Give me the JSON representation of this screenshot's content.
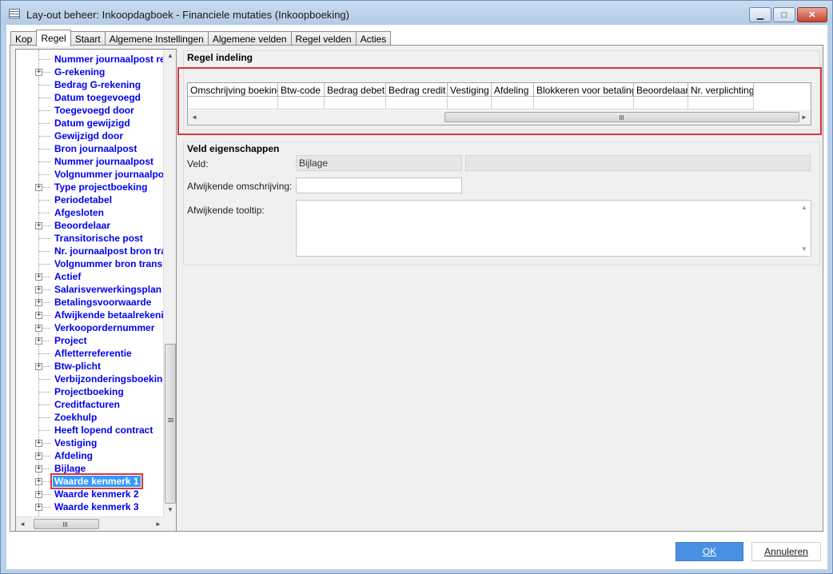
{
  "window": {
    "title": "Lay-out beheer: Inkoopdagboek - Financiele mutaties (Inkoopboeking)",
    "controls": {
      "minimize": "▁",
      "maximize": "□",
      "close": "✕"
    }
  },
  "tabs": [
    "Kop",
    "Regel",
    "Staart",
    "Algemene Instellingen",
    "Algemene velden",
    "Regel velden",
    "Acties"
  ],
  "active_tab": "Regel",
  "tree": {
    "items": [
      {
        "label": "Nummer journaalpost rek",
        "expandable": false
      },
      {
        "label": "G-rekening",
        "expandable": true
      },
      {
        "label": "Bedrag G-rekening",
        "expandable": false
      },
      {
        "label": "Datum toegevoegd",
        "expandable": false
      },
      {
        "label": "Toegevoegd door",
        "expandable": false
      },
      {
        "label": "Datum gewijzigd",
        "expandable": false
      },
      {
        "label": "Gewijzigd door",
        "expandable": false
      },
      {
        "label": "Bron journaalpost",
        "expandable": false
      },
      {
        "label": "Nummer journaalpost",
        "expandable": false
      },
      {
        "label": "Volgnummer journaalpos",
        "expandable": false
      },
      {
        "label": "Type projectboeking",
        "expandable": true
      },
      {
        "label": "Periodetabel",
        "expandable": false
      },
      {
        "label": "Afgesloten",
        "expandable": false
      },
      {
        "label": "Beoordelaar",
        "expandable": true
      },
      {
        "label": "Transitorische post",
        "expandable": false
      },
      {
        "label": "Nr. journaalpost bron tra",
        "expandable": false
      },
      {
        "label": "Volgnummer bron transit",
        "expandable": false
      },
      {
        "label": "Actief",
        "expandable": true
      },
      {
        "label": "Salarisverwerkingsplan",
        "expandable": true
      },
      {
        "label": "Betalingsvoorwaarde",
        "expandable": true
      },
      {
        "label": "Afwijkende betaalrekeni",
        "expandable": true
      },
      {
        "label": "Verkoopordernummer",
        "expandable": true
      },
      {
        "label": "Project",
        "expandable": true
      },
      {
        "label": "Afletterreferentie",
        "expandable": false
      },
      {
        "label": "Btw-plicht",
        "expandable": true
      },
      {
        "label": "Verbijzonderingsboeking",
        "expandable": false
      },
      {
        "label": "Projectboeking",
        "expandable": false
      },
      {
        "label": "Creditfacturen",
        "expandable": false
      },
      {
        "label": "Zoekhulp",
        "expandable": false
      },
      {
        "label": "Heeft lopend contract",
        "expandable": false
      },
      {
        "label": "Vestiging",
        "expandable": true
      },
      {
        "label": "Afdeling",
        "expandable": true
      },
      {
        "label": "Bijlage",
        "expandable": true
      },
      {
        "label": "Waarde kenmerk 1",
        "expandable": true,
        "selected": true
      },
      {
        "label": "Waarde kenmerk 2",
        "expandable": true
      },
      {
        "label": "Waarde kenmerk 3",
        "expandable": true
      }
    ],
    "scroll_icons": {
      "up": "▲",
      "down": "▼",
      "left": "◄",
      "right": "►",
      "grip": "≡",
      "hgrip": "III"
    }
  },
  "regel_indeling": {
    "title": "Regel indeling",
    "columns": [
      {
        "label": "Omschrijving boeking"
      },
      {
        "label": "Btw-code"
      },
      {
        "label": "Bedrag debet"
      },
      {
        "label": "Bedrag credit"
      },
      {
        "label": "Vestiging"
      },
      {
        "label": "Afdeling"
      },
      {
        "label": "Blokkeren voor betaling"
      },
      {
        "label": "Beoordelaar"
      },
      {
        "label": "Nr. verplichting"
      }
    ]
  },
  "veld_eigenschappen": {
    "title": "Veld eigenschappen",
    "veld_label": "Veld:",
    "veld_value": "Bijlage",
    "veld_extra": "",
    "omschrijving_label": "Afwijkende omschrijving:",
    "omschrijving_value": "",
    "tooltip_label": "Afwijkende tooltip:",
    "tooltip_value": ""
  },
  "buttons": {
    "ok": "OK",
    "cancel": "Annuleren"
  },
  "colors": {
    "accent": "#3399ff",
    "highlight": "#d9373a",
    "tree_text": "#0000ee",
    "ok_button": "#4a90e2"
  }
}
